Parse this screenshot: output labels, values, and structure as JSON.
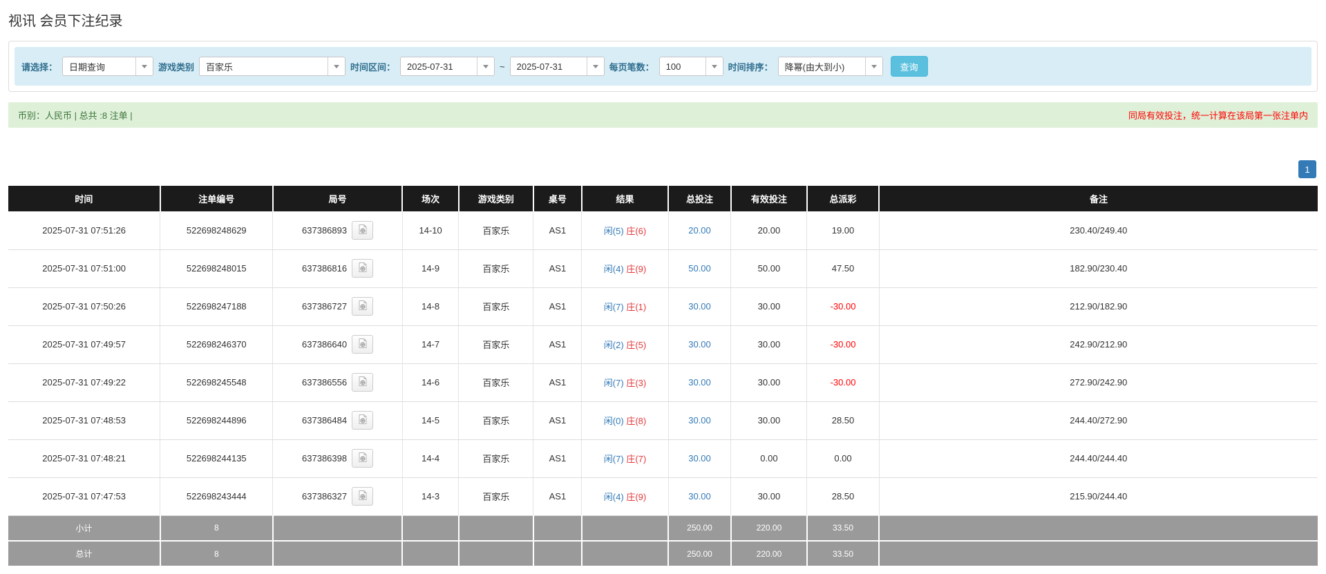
{
  "page": {
    "title": "视讯 会员下注纪录"
  },
  "filters": {
    "mode_label": "请选择：",
    "mode_value": "日期查询",
    "game_label": "游戏类别",
    "game_value": "百家乐",
    "range_label": "时间区间：",
    "date_from": "2025-07-31",
    "tilde": "~",
    "date_to": "2025-07-31",
    "per_page_label": "每页笔数：",
    "per_page_value": "100",
    "sort_label": "时间排序：",
    "sort_value": "降幂(由大到小)",
    "search_label": "查询"
  },
  "summary": {
    "left_text": "币别：人民币 | 总共 :8 注单 |",
    "right_note": "同局有效投注，统一计算在该局第一张注单内"
  },
  "pagination": {
    "current_page": "1"
  },
  "icons": {
    "dropdown": "caret-down-icon",
    "round_video": "video-record-icon"
  },
  "colors": {
    "filter_bar_bg": "#d9edf7",
    "filter_label": "#31708f",
    "search_button_bg": "#5bc0de",
    "summary_bar_bg": "#dff0d8",
    "summary_text": "#3c763d",
    "warning_text": "#ff0000",
    "table_header_bg": "#1b1b1b",
    "table_footer_bg": "#9a9a9a",
    "link_blue": "#337ab7",
    "player_blue": "#337ab7",
    "banker_red": "#e4393c",
    "negative_red": "#ff0000",
    "pagination_active_bg": "#337ab7"
  },
  "table": {
    "headers": [
      "时间",
      "注单编号",
      "局号",
      "场次",
      "游戏类别",
      "桌号",
      "结果",
      "总投注",
      "有效投注",
      "总派彩",
      "备注"
    ],
    "col_widths": [
      "11.6%",
      "8.6%",
      "9.9%",
      "4.3%",
      "5.7%",
      "3.7%",
      "6.6%",
      "4.8%",
      "5.8%",
      "5.5%",
      "33.5%"
    ],
    "rows": [
      {
        "time": "2025-07-31 07:51:26",
        "bet_id": "522698248629",
        "round_id": "637386893",
        "session": "14-10",
        "game": "百家乐",
        "table_no": "AS1",
        "result_player": "闲(5)",
        "result_banker": "庄(6)",
        "total_bet": "20.00",
        "valid_bet": "20.00",
        "payout": "19.00",
        "payout_negative": false,
        "remark": "230.40/249.40"
      },
      {
        "time": "2025-07-31 07:51:00",
        "bet_id": "522698248015",
        "round_id": "637386816",
        "session": "14-9",
        "game": "百家乐",
        "table_no": "AS1",
        "result_player": "闲(4)",
        "result_banker": "庄(9)",
        "total_bet": "50.00",
        "valid_bet": "50.00",
        "payout": "47.50",
        "payout_negative": false,
        "remark": "182.90/230.40"
      },
      {
        "time": "2025-07-31 07:50:26",
        "bet_id": "522698247188",
        "round_id": "637386727",
        "session": "14-8",
        "game": "百家乐",
        "table_no": "AS1",
        "result_player": "闲(7)",
        "result_banker": "庄(1)",
        "total_bet": "30.00",
        "valid_bet": "30.00",
        "payout": "-30.00",
        "payout_negative": true,
        "remark": "212.90/182.90"
      },
      {
        "time": "2025-07-31 07:49:57",
        "bet_id": "522698246370",
        "round_id": "637386640",
        "session": "14-7",
        "game": "百家乐",
        "table_no": "AS1",
        "result_player": "闲(2)",
        "result_banker": "庄(5)",
        "total_bet": "30.00",
        "valid_bet": "30.00",
        "payout": "-30.00",
        "payout_negative": true,
        "remark": "242.90/212.90"
      },
      {
        "time": "2025-07-31 07:49:22",
        "bet_id": "522698245548",
        "round_id": "637386556",
        "session": "14-6",
        "game": "百家乐",
        "table_no": "AS1",
        "result_player": "闲(7)",
        "result_banker": "庄(3)",
        "total_bet": "30.00",
        "valid_bet": "30.00",
        "payout": "-30.00",
        "payout_negative": true,
        "remark": "272.90/242.90"
      },
      {
        "time": "2025-07-31 07:48:53",
        "bet_id": "522698244896",
        "round_id": "637386484",
        "session": "14-5",
        "game": "百家乐",
        "table_no": "AS1",
        "result_player": "闲(0)",
        "result_banker": "庄(8)",
        "total_bet": "30.00",
        "valid_bet": "30.00",
        "payout": "28.50",
        "payout_negative": false,
        "remark": "244.40/272.90"
      },
      {
        "time": "2025-07-31 07:48:21",
        "bet_id": "522698244135",
        "round_id": "637386398",
        "session": "14-4",
        "game": "百家乐",
        "table_no": "AS1",
        "result_player": "闲(7)",
        "result_banker": "庄(7)",
        "total_bet": "30.00",
        "valid_bet": "0.00",
        "payout": "0.00",
        "payout_negative": false,
        "remark": "244.40/244.40"
      },
      {
        "time": "2025-07-31 07:47:53",
        "bet_id": "522698243444",
        "round_id": "637386327",
        "session": "14-3",
        "game": "百家乐",
        "table_no": "AS1",
        "result_player": "闲(4)",
        "result_banker": "庄(9)",
        "total_bet": "30.00",
        "valid_bet": "30.00",
        "payout": "28.50",
        "payout_negative": false,
        "remark": "215.90/244.40"
      }
    ],
    "subtotal": {
      "label": "小计",
      "count": "8",
      "total_bet": "250.00",
      "valid_bet": "220.00",
      "payout": "33.50"
    },
    "total": {
      "label": "总计",
      "count": "8",
      "total_bet": "250.00",
      "valid_bet": "220.00",
      "payout": "33.50"
    }
  }
}
